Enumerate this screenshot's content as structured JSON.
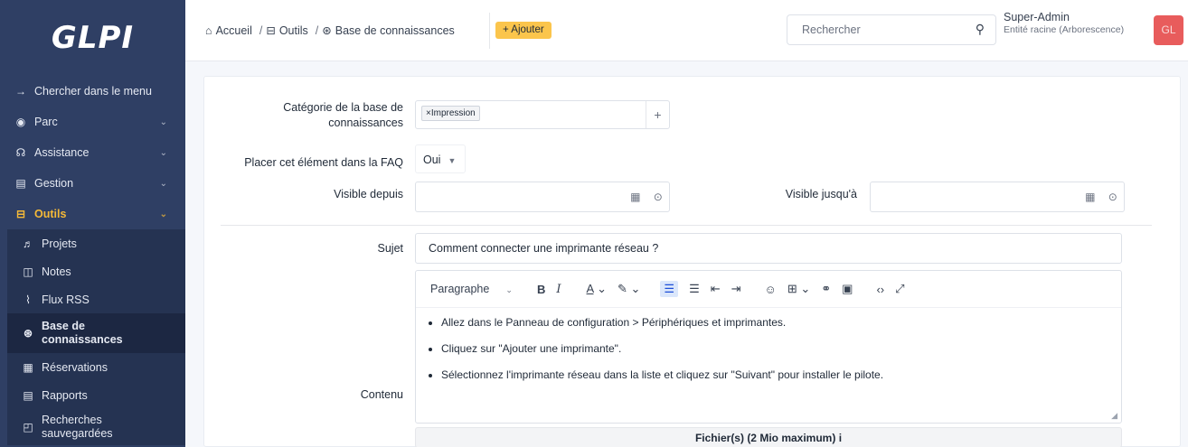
{
  "sidebar": {
    "logo": "GLPI",
    "items": [
      {
        "label": "Chercher dans le menu",
        "icon": "→"
      },
      {
        "label": "Parc",
        "icon": "◉"
      },
      {
        "label": "Assistance",
        "icon": "☊"
      },
      {
        "label": "Gestion",
        "icon": "▤"
      },
      {
        "label": "Outils",
        "icon": "⊟"
      }
    ],
    "submenu": [
      {
        "label": "Projets",
        "icon": "♬"
      },
      {
        "label": "Notes",
        "icon": "◫"
      },
      {
        "label": "Flux RSS",
        "icon": "⌇"
      },
      {
        "label1": "Base de",
        "label2": "connaissances",
        "icon": "⊛"
      },
      {
        "label": "Réservations",
        "icon": "▦"
      },
      {
        "label": "Rapports",
        "icon": "▤"
      },
      {
        "label1": "Recherches",
        "label2": "sauvegardées",
        "icon": "◰"
      }
    ]
  },
  "header": {
    "breadcrumb": [
      "Accueil",
      "Outils",
      "Base de connaissances"
    ],
    "add_label": "+ Ajouter",
    "search_placeholder": "Rechercher",
    "user_name": "Super-Admin",
    "entity": "Entité racine (Arborescence)",
    "avatar": "GL"
  },
  "form": {
    "category_label_1": "Catégorie de la base de",
    "category_label_2": "connaissances",
    "category_tag": "×Impression",
    "faq_label": "Placer cet élément dans la FAQ",
    "faq_value": "Oui",
    "visible_from_label": "Visible depuis",
    "visible_until_label": "Visible jusqu'à",
    "subject_label": "Sujet",
    "subject_value": "Comment connecter une imprimante réseau ?",
    "content_label": "Contenu",
    "paragraph": "Paragraphe",
    "content_items": [
      "Allez dans le Panneau de configuration > Périphériques et imprimantes.",
      "Cliquez sur \"Ajouter une imprimante\".",
      "Sélectionnez l'imprimante réseau dans la liste et cliquez sur \"Suivant\" pour installer le pilote."
    ],
    "files_label": "Fichier(s) (2 Mio maximum)",
    "files_info": "i"
  },
  "colors": {
    "sidebar_bg": "#2f3f64",
    "active_accent": "#f5b937",
    "add_button": "#fbc54c",
    "avatar_bg": "#e85c5c"
  }
}
